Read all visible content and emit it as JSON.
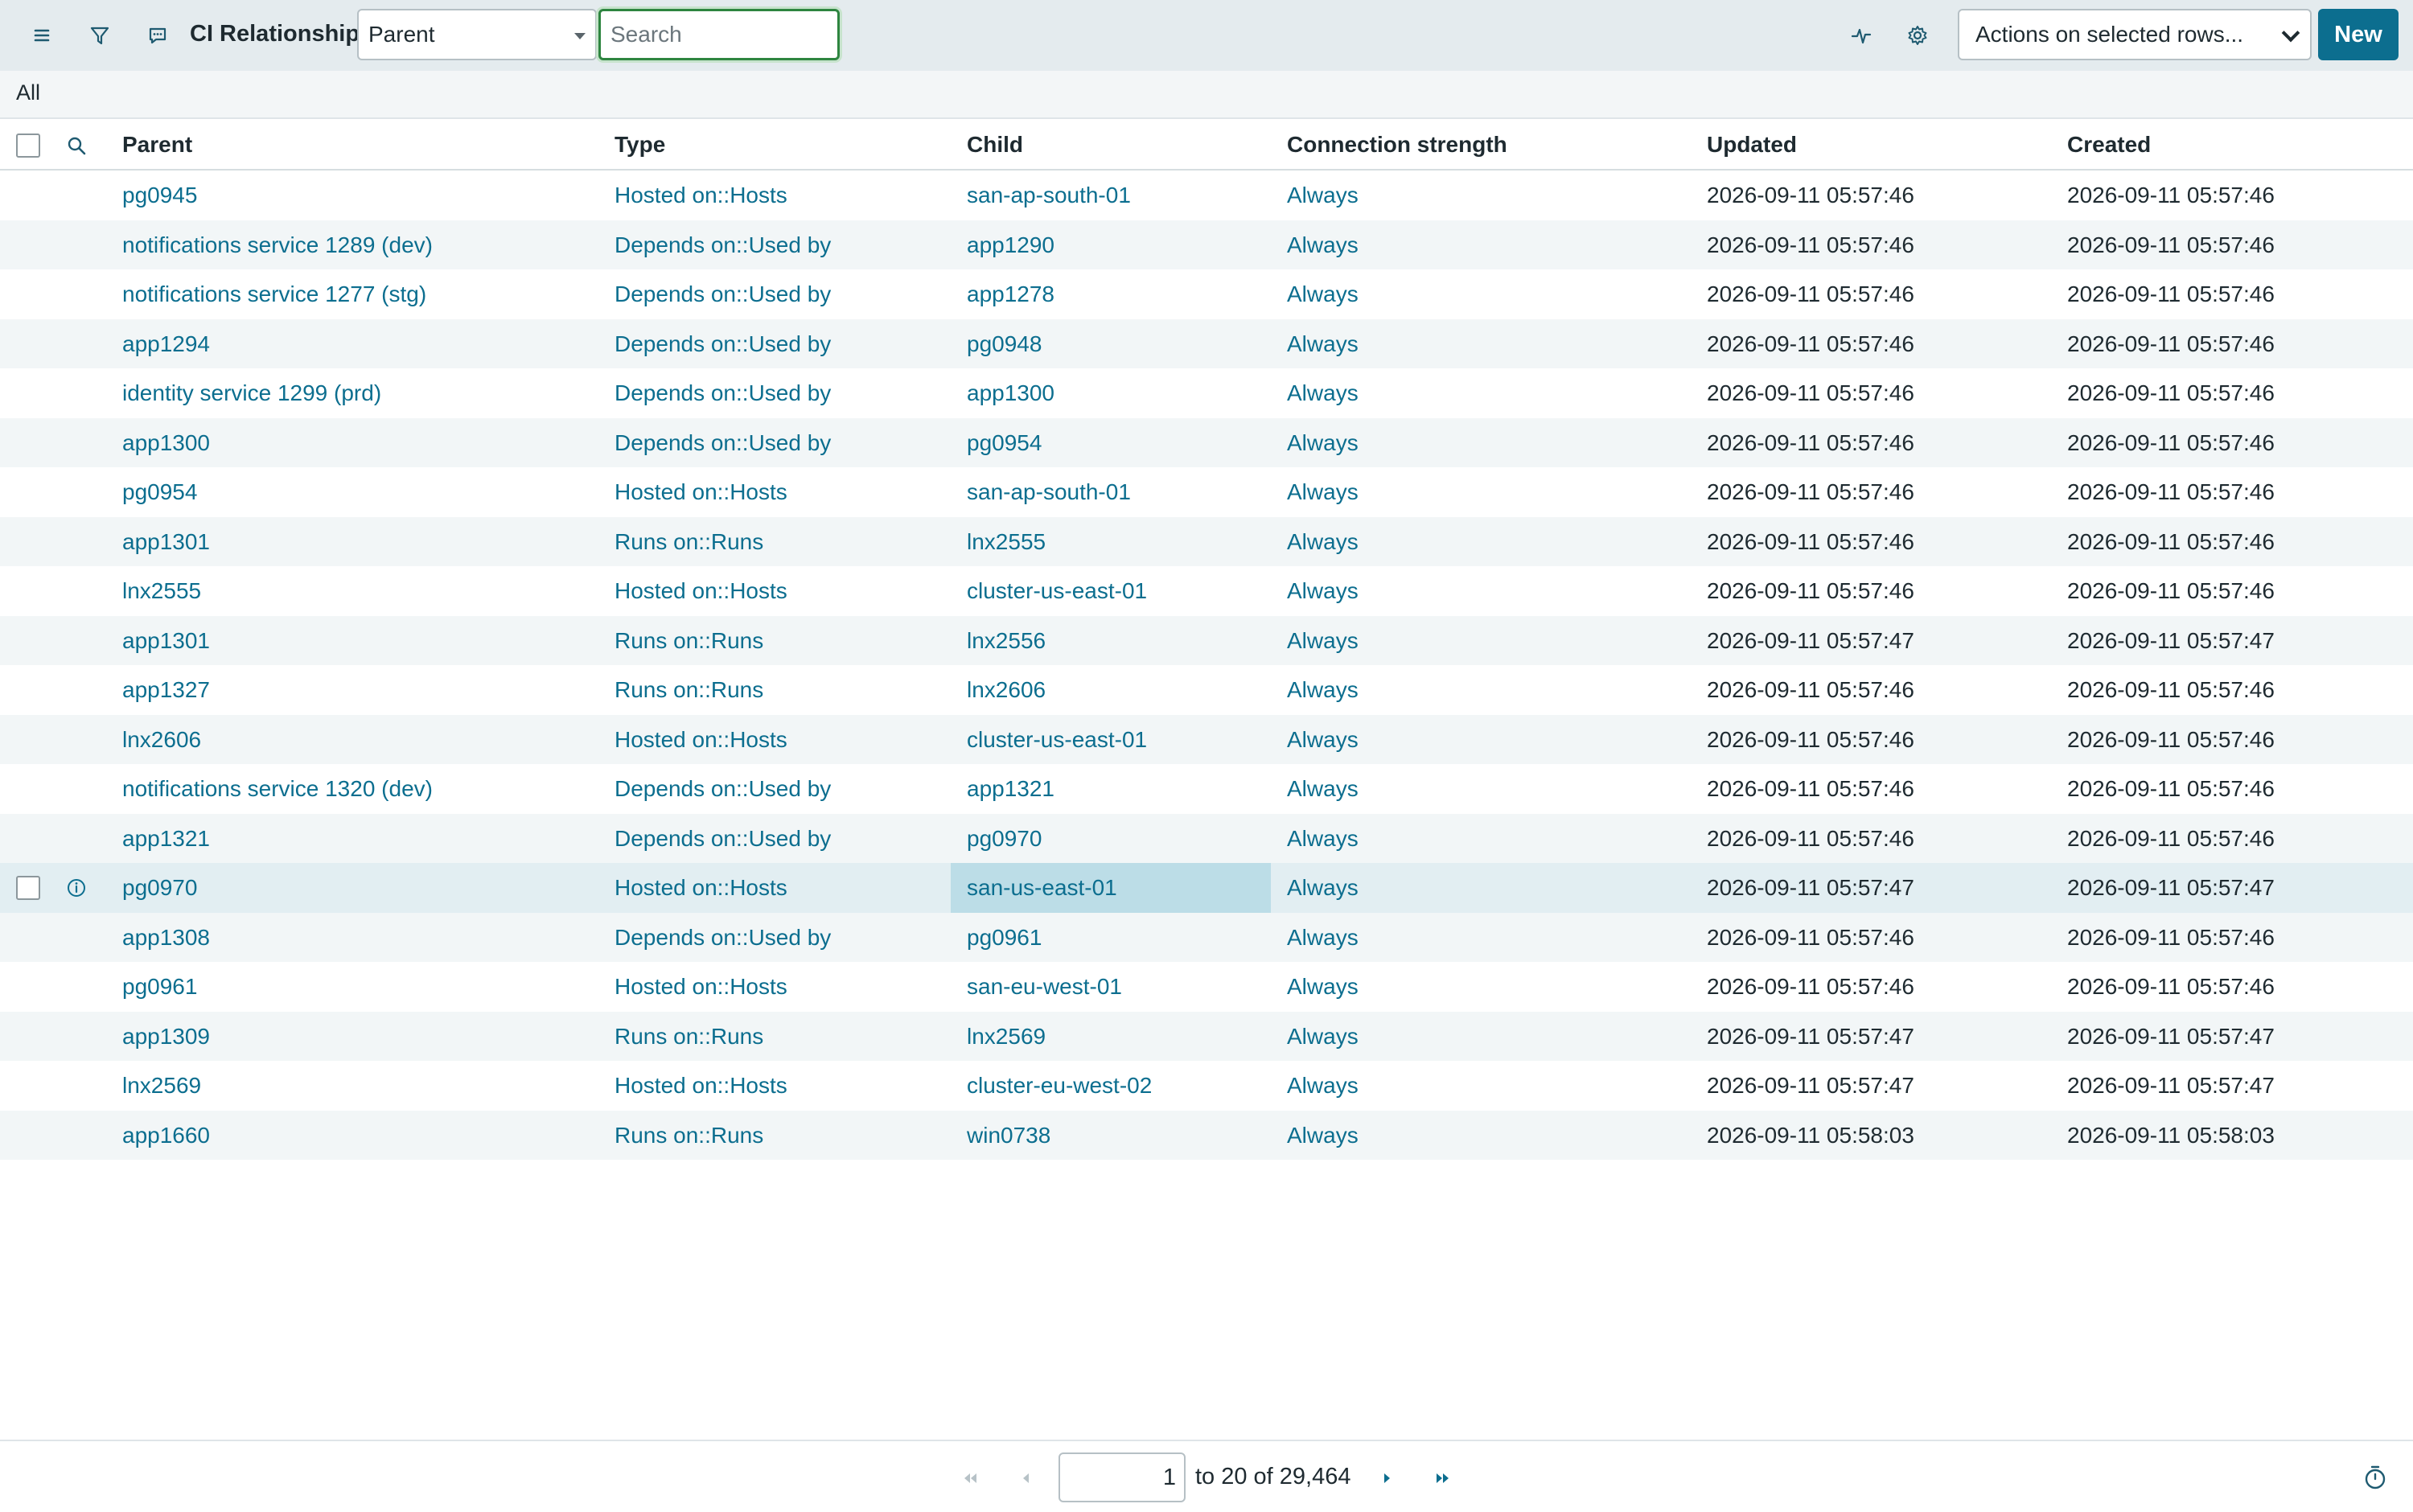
{
  "header": {
    "menu_icon": "hamburger-menu-icon",
    "filter_icon": "filter-icon",
    "comment_icon": "comment-icon",
    "title": "CI Relationships",
    "search_field": "Parent",
    "search_placeholder": "Search",
    "activity_icon": "activity-pulse-icon",
    "settings_icon": "gear-icon",
    "actions_label": "Actions on selected rows...",
    "new_label": "New"
  },
  "breadcrumb": {
    "label": "All"
  },
  "table": {
    "columns": [
      "Parent",
      "Type",
      "Child",
      "Connection strength",
      "Updated",
      "Created"
    ],
    "rows": [
      {
        "parent": "pg0945",
        "type": "Hosted on::Hosts",
        "child": "san-ap-south-01",
        "strength": "Always",
        "updated": "2026-09-11 05:57:46",
        "created": "2026-09-11 05:57:46"
      },
      {
        "parent": "notifications service 1289 (dev)",
        "type": "Depends on::Used by",
        "child": "app1290",
        "strength": "Always",
        "updated": "2026-09-11 05:57:46",
        "created": "2026-09-11 05:57:46"
      },
      {
        "parent": "notifications service 1277 (stg)",
        "type": "Depends on::Used by",
        "child": "app1278",
        "strength": "Always",
        "updated": "2026-09-11 05:57:46",
        "created": "2026-09-11 05:57:46"
      },
      {
        "parent": "app1294",
        "type": "Depends on::Used by",
        "child": "pg0948",
        "strength": "Always",
        "updated": "2026-09-11 05:57:46",
        "created": "2026-09-11 05:57:46"
      },
      {
        "parent": "identity service 1299 (prd)",
        "type": "Depends on::Used by",
        "child": "app1300",
        "strength": "Always",
        "updated": "2026-09-11 05:57:46",
        "created": "2026-09-11 05:57:46"
      },
      {
        "parent": "app1300",
        "type": "Depends on::Used by",
        "child": "pg0954",
        "strength": "Always",
        "updated": "2026-09-11 05:57:46",
        "created": "2026-09-11 05:57:46"
      },
      {
        "parent": "pg0954",
        "type": "Hosted on::Hosts",
        "child": "san-ap-south-01",
        "strength": "Always",
        "updated": "2026-09-11 05:57:46",
        "created": "2026-09-11 05:57:46"
      },
      {
        "parent": "app1301",
        "type": "Runs on::Runs",
        "child": "lnx2555",
        "strength": "Always",
        "updated": "2026-09-11 05:57:46",
        "created": "2026-09-11 05:57:46"
      },
      {
        "parent": "lnx2555",
        "type": "Hosted on::Hosts",
        "child": "cluster-us-east-01",
        "strength": "Always",
        "updated": "2026-09-11 05:57:46",
        "created": "2026-09-11 05:57:46"
      },
      {
        "parent": "app1301",
        "type": "Runs on::Runs",
        "child": "lnx2556",
        "strength": "Always",
        "updated": "2026-09-11 05:57:47",
        "created": "2026-09-11 05:57:47"
      },
      {
        "parent": "app1327",
        "type": "Runs on::Runs",
        "child": "lnx2606",
        "strength": "Always",
        "updated": "2026-09-11 05:57:46",
        "created": "2026-09-11 05:57:46"
      },
      {
        "parent": "lnx2606",
        "type": "Hosted on::Hosts",
        "child": "cluster-us-east-01",
        "strength": "Always",
        "updated": "2026-09-11 05:57:46",
        "created": "2026-09-11 05:57:46"
      },
      {
        "parent": "notifications service 1320 (dev)",
        "type": "Depends on::Used by",
        "child": "app1321",
        "strength": "Always",
        "updated": "2026-09-11 05:57:46",
        "created": "2026-09-11 05:57:46"
      },
      {
        "parent": "app1321",
        "type": "Depends on::Used by",
        "child": "pg0970",
        "strength": "Always",
        "updated": "2026-09-11 05:57:46",
        "created": "2026-09-11 05:57:46"
      },
      {
        "parent": "pg0970",
        "type": "Hosted on::Hosts",
        "child": "san-us-east-01",
        "strength": "Always",
        "updated": "2026-09-11 05:57:47",
        "created": "2026-09-11 05:57:47"
      },
      {
        "parent": "app1308",
        "type": "Depends on::Used by",
        "child": "pg0961",
        "strength": "Always",
        "updated": "2026-09-11 05:57:46",
        "created": "2026-09-11 05:57:46"
      },
      {
        "parent": "pg0961",
        "type": "Hosted on::Hosts",
        "child": "san-eu-west-01",
        "strength": "Always",
        "updated": "2026-09-11 05:57:46",
        "created": "2026-09-11 05:57:46"
      },
      {
        "parent": "app1309",
        "type": "Runs on::Runs",
        "child": "lnx2569",
        "strength": "Always",
        "updated": "2026-09-11 05:57:47",
        "created": "2026-09-11 05:57:47"
      },
      {
        "parent": "lnx2569",
        "type": "Hosted on::Hosts",
        "child": "cluster-eu-west-02",
        "strength": "Always",
        "updated": "2026-09-11 05:57:47",
        "created": "2026-09-11 05:57:47"
      },
      {
        "parent": "app1660",
        "type": "Runs on::Runs",
        "child": "win0738",
        "strength": "Always",
        "updated": "2026-09-11 05:58:03",
        "created": "2026-09-11 05:58:03"
      }
    ]
  },
  "pagination": {
    "first_icon": "double-chevron-left-icon",
    "prev_icon": "chevron-left-icon",
    "next_icon": "chevron-right-icon",
    "last_icon": "double-chevron-right-icon",
    "current": "1",
    "range_text": "to 20 of 29,464",
    "timer_icon": "stopwatch-icon"
  },
  "colors": {
    "link": "#0c6e8f",
    "header_bg": "#e4ebee",
    "new_button": "#0c6e8f",
    "search_focus": "#2e8540",
    "row_stripe": "#f2f6f7",
    "selected_cell": "#bcdde7"
  }
}
